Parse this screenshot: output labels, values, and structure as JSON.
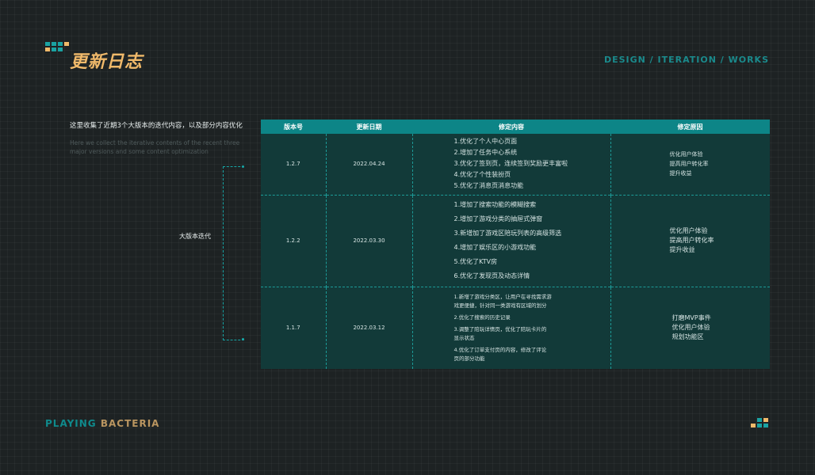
{
  "header": {
    "title": "更新日志",
    "right_text": "DESIGN / ITERATION / WORKS"
  },
  "intro": {
    "cn": "这里收集了近期3个大版本的迭代内容，以及部分内容优化",
    "en": "Here we collect the iterative contents of the recent three major versions and some content optimization"
  },
  "side_label": "大版本迭代",
  "table": {
    "headers": [
      "版本号",
      "更新日期",
      "修定内容",
      "修定原因"
    ],
    "rows": [
      {
        "version": "1.2.7",
        "date": "2022.04.24",
        "mods": [
          "1.优化了个人中心页面",
          "2.增加了任务中心系统",
          "3.优化了签到页，连续签到奖励更丰富啦",
          "4.优化了个性装扮页",
          "5.优化了消息页消息功能"
        ],
        "reasons": [
          "优化用户体验",
          "提高用户转化率",
          "提升收益"
        ]
      },
      {
        "version": "1.2.2",
        "date": "2022.03.30",
        "mods": [
          "1.增加了搜索功能的模糊搜索",
          "2.增加了游戏分类的抽屉式弹窗",
          "3.新增加了游戏区陪玩列表的高级筛选",
          "4.增加了娱乐区的小游戏功能",
          "5.优化了KTV房",
          "6.优化了发现页及动态详情"
        ],
        "reasons": [
          "优化用户体验",
          "提高用户转化率",
          "提升收益"
        ]
      },
      {
        "version": "1.1.7",
        "date": "2022.03.12",
        "mods": [
          "1.新增了游戏分类区，让用户在寻找需求游",
          "戏更便捷，针对同一类游戏有区域的划分",
          "2.优化了搜索的历史记录",
          "3.调整了陪玩详情页，优化了陪玩卡片的",
          "显示状态",
          "4.优化了订单支付页的内容，修改了评论",
          "页的部分功能"
        ],
        "reasons": [
          "打磨MVP事件",
          "优化用户体验",
          "规划功能区"
        ]
      }
    ]
  },
  "footer": {
    "brand_part1": "PLAYING",
    "brand_part2": "BACTERIA"
  },
  "colors": {
    "background": "#1d2223",
    "accent_teal": "#0d8587",
    "accent_orange": "#f0b96a",
    "table_body": "#123a39"
  }
}
